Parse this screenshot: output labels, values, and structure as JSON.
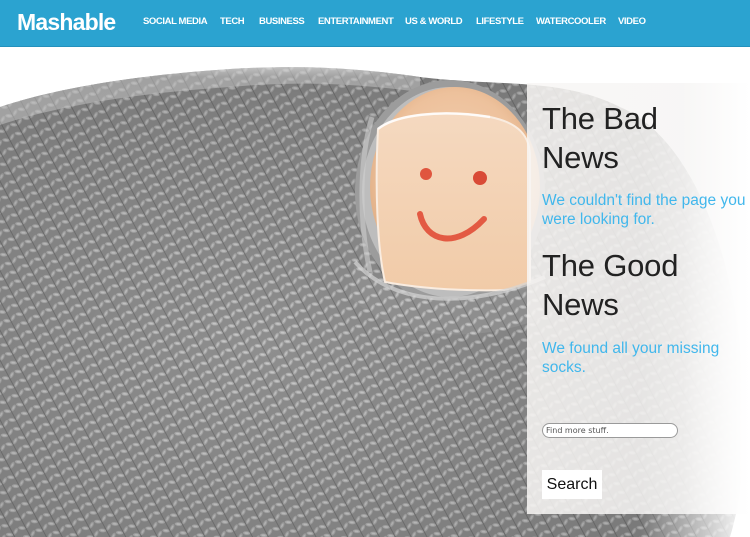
{
  "brand": {
    "logo_text": "Mashable",
    "colors": {
      "header_bg": "#2ba3d0",
      "accent_text": "#41b7ec",
      "heading_text": "#222222"
    }
  },
  "nav": {
    "items": [
      {
        "label": "SOCIAL MEDIA"
      },
      {
        "label": "TECH"
      },
      {
        "label": "BUSINESS"
      },
      {
        "label": "ENTERTAINMENT"
      },
      {
        "label": "US & WORLD"
      },
      {
        "label": "LIFESTYLE"
      },
      {
        "label": "WATERCOOLER"
      },
      {
        "label": "VIDEO"
      }
    ]
  },
  "hero": {
    "image_description": "grey knitted sock with a hole, big toe poking through with a smiley face drawn on the nail",
    "icons": {
      "smiley": "smiley-face-drawing"
    }
  },
  "panel": {
    "bad_news_heading": "The Bad News",
    "bad_news_text": "We couldn't find the page you were looking for.",
    "good_news_heading": "The Good News",
    "good_news_text": "We found all your missing socks.",
    "search": {
      "placeholder": "Find more stuff.",
      "value": "",
      "button_label": "Search"
    }
  }
}
